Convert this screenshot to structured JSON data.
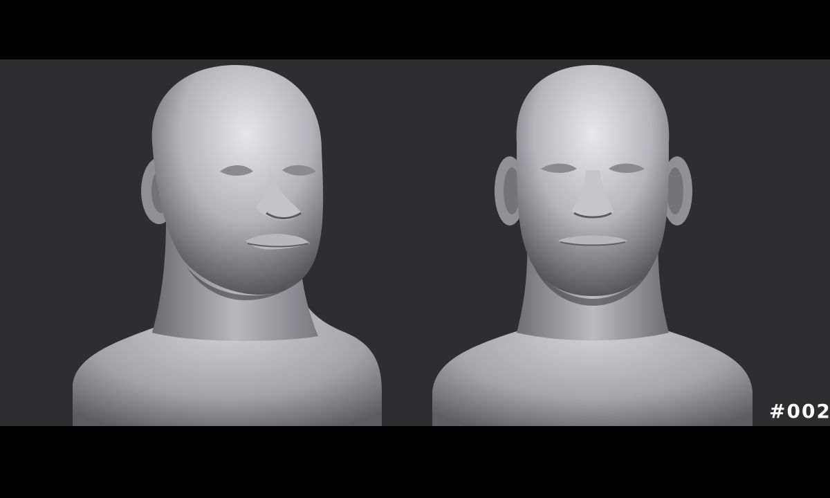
{
  "scene": {
    "background_color": "#2e2e31",
    "letterbox_color": "#000000",
    "clay_color": "#a9a9ad",
    "label_color": "#ffffff"
  },
  "label": {
    "text": "#002"
  },
  "busts": [
    {
      "view": "three-quarter"
    },
    {
      "view": "front"
    }
  ]
}
